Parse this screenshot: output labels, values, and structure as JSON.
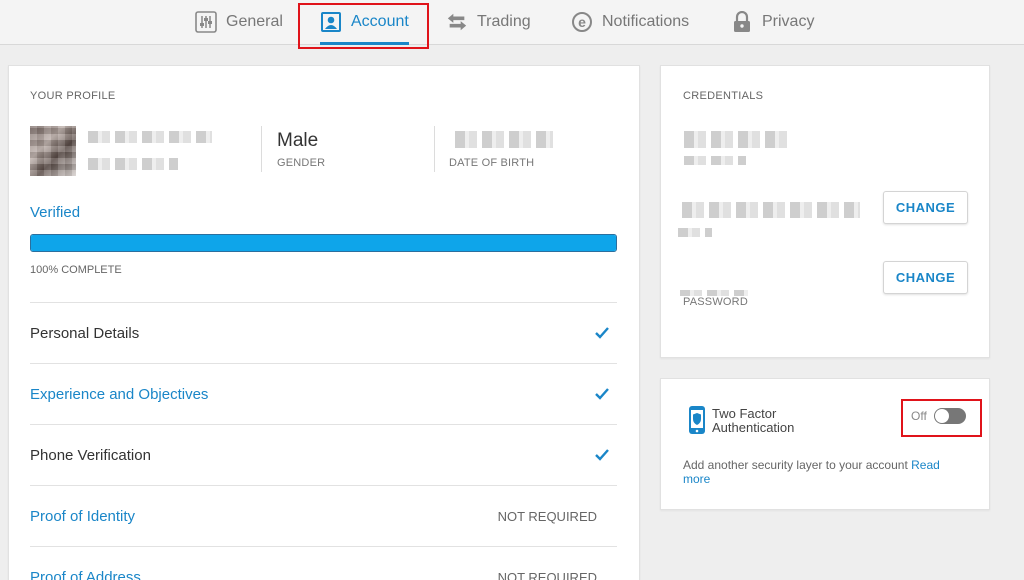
{
  "tabs": [
    {
      "label": "General",
      "icon": "sliders-icon"
    },
    {
      "label": "Account",
      "icon": "user-icon",
      "active": true
    },
    {
      "label": "Trading",
      "icon": "transfer-arrows-icon"
    },
    {
      "label": "Notifications",
      "icon": "notification-icon"
    },
    {
      "label": "Privacy",
      "icon": "lock-icon"
    }
  ],
  "profile": {
    "section_label": "YOUR PROFILE",
    "gender_value": "Male",
    "gender_label": "GENDER",
    "dob_label": "DATE OF BIRTH",
    "verified_label": "Verified",
    "progress_percent": 100,
    "progress_text": "100% COMPLETE",
    "rows": [
      {
        "label": "Personal Details",
        "link": false,
        "status": "",
        "checked": true
      },
      {
        "label": "Experience and Objectives",
        "link": true,
        "status": "",
        "checked": true
      },
      {
        "label": "Phone Verification",
        "link": false,
        "status": "",
        "checked": true
      },
      {
        "label": "Proof of Identity",
        "link": true,
        "status": "NOT REQUIRED",
        "checked": false
      },
      {
        "label": "Proof of Address",
        "link": true,
        "status": "NOT REQUIRED",
        "checked": false
      }
    ]
  },
  "credentials": {
    "section_label": "CREDENTIALS",
    "change_label": "CHANGE",
    "password_label": "PASSWORD"
  },
  "two_factor": {
    "title": "Two Factor Authentication",
    "toggle_state": "Off",
    "description": "Add another security layer to your account",
    "read_more": "Read more"
  },
  "colors": {
    "accent": "#1a86c8",
    "progress_fill": "#0ea5ea",
    "highlight": "#e0131a"
  }
}
